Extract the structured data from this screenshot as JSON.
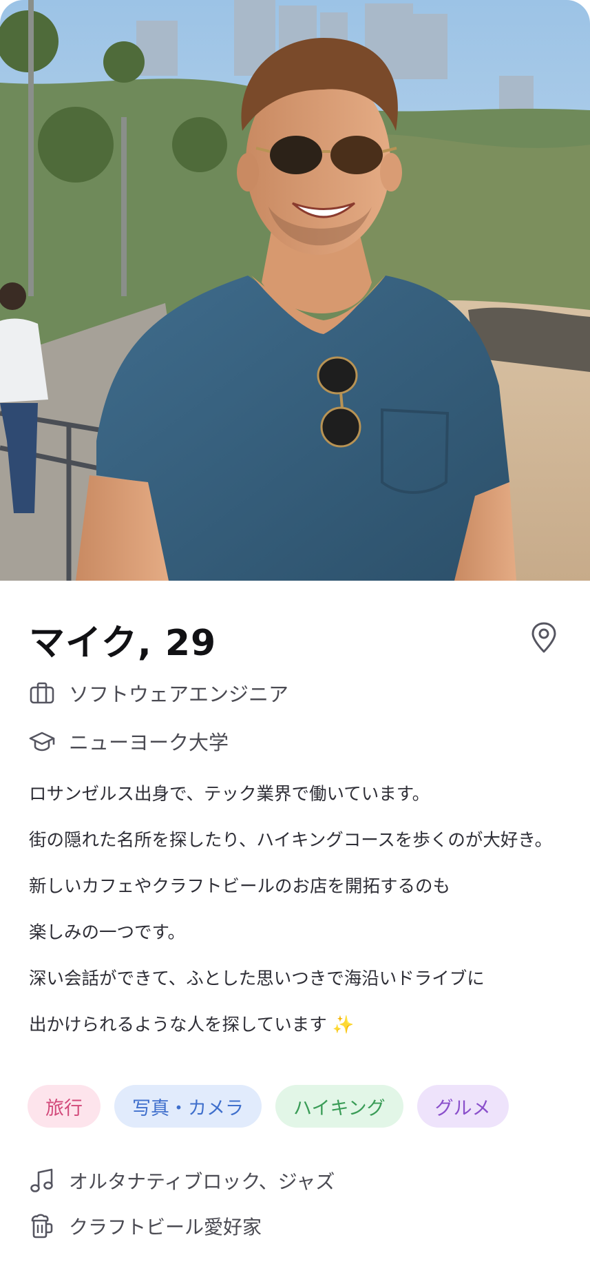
{
  "profile": {
    "name_age": "マイク, 29",
    "job": "ソフトウェアエンジニア",
    "school": "ニューヨーク大学",
    "bio": [
      "ロサンゼルス出身で、テック業界で働いています。",
      "街の隠れた名所を探したり、ハイキングコースを歩くのが大好き。",
      "新しいカフェやクラフトビールのお店を開拓するのも",
      "楽しみの一つです。",
      "深い会話ができて、ふとした思いつきで海沿いドライブに",
      "出かけられるような人を探しています ✨"
    ],
    "tags": [
      "旅行",
      "写真・カメラ",
      "ハイキング",
      "グルメ"
    ],
    "music": "オルタナティブロック、ジャズ",
    "drink": "クラフトビール愛好家"
  },
  "icons": {
    "location": "location-pin-icon",
    "job": "briefcase-icon",
    "school": "graduation-cap-icon",
    "music": "music-note-icon",
    "drink": "beer-mug-icon"
  },
  "colors": {
    "tag_travel": "#d2497a",
    "tag_photo": "#3f6fcc",
    "tag_hiking": "#3a9c57",
    "tag_gourmet": "#8a4fcb"
  }
}
